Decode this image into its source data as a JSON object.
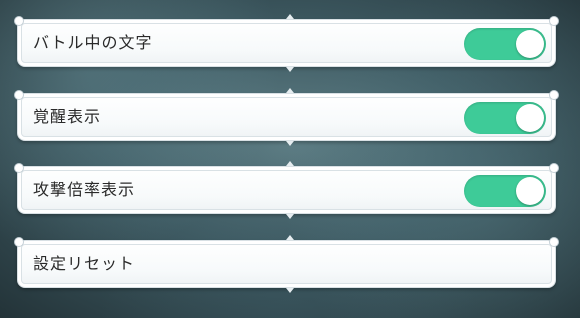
{
  "settings": {
    "items": [
      {
        "label": "バトル中の文字",
        "toggle": true,
        "enabled": true
      },
      {
        "label": "覚醒表示",
        "toggle": true,
        "enabled": true
      },
      {
        "label": "攻撃倍率表示",
        "toggle": true,
        "enabled": true
      },
      {
        "label": "設定リセット",
        "toggle": false
      }
    ]
  },
  "colors": {
    "toggle_on": "#3ecb98",
    "panel_bg": "#ffffff",
    "label_text": "#2a2a2a",
    "background": "#3e5a62"
  }
}
